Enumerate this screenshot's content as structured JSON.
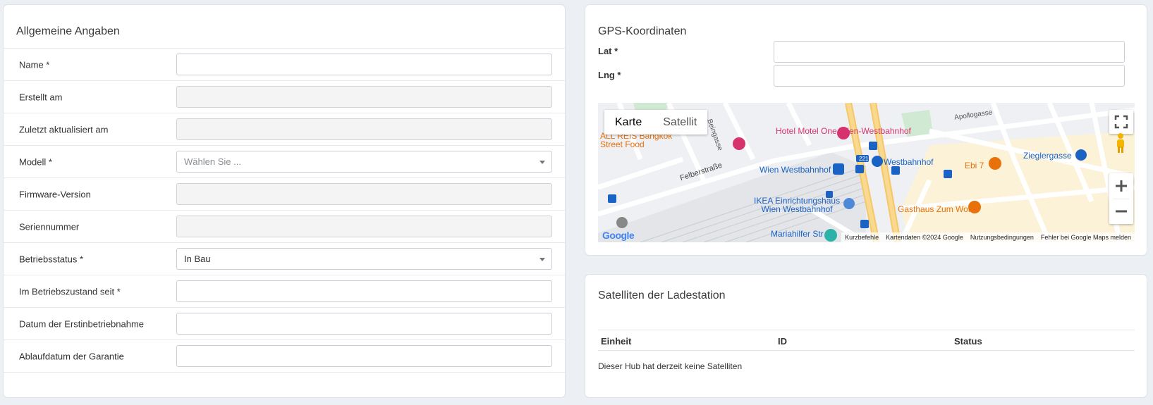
{
  "general": {
    "title": "Allgemeine Angaben",
    "fields": [
      {
        "label": "Name *",
        "value": "",
        "type": "input"
      },
      {
        "label": "Erstellt am",
        "value": "",
        "type": "readonly"
      },
      {
        "label": "Zuletzt aktualisiert am",
        "value": "",
        "type": "readonly"
      },
      {
        "label": "Modell *",
        "value": "Wählen Sie ...",
        "type": "select-placeholder"
      },
      {
        "label": "Firmware-Version",
        "value": "",
        "type": "readonly"
      },
      {
        "label": "Seriennummer",
        "value": "",
        "type": "readonly"
      },
      {
        "label": "Betriebsstatus *",
        "value": "In Bau",
        "type": "select"
      },
      {
        "label": "Im Betriebszustand seit *",
        "value": "",
        "type": "input"
      },
      {
        "label": "Datum der Erstinbetriebnahme",
        "value": "",
        "type": "input"
      },
      {
        "label": "Ablaufdatum der Garantie",
        "value": "",
        "type": "input"
      }
    ]
  },
  "gps": {
    "title": "GPS-Koordinaten",
    "lat_label": "Lat *",
    "lng_label": "Lng *",
    "lat_value": "",
    "lng_value": "",
    "map": {
      "type_map": "Karte",
      "type_satellite": "Satellit",
      "footer": [
        "Kurzbefehle",
        "Kartendaten ©2024 Google",
        "Nutzungsbedingungen",
        "Fehler bei Google Maps melden"
      ],
      "google_logo": "Google",
      "places": [
        {
          "name": "Hotel Motel One\nWien-Westbahnhof",
          "color": "#d6336c"
        },
        {
          "name": "ALL REIS Bangkok\nStreet Food",
          "color": "#e8710a"
        },
        {
          "name": "Felberstraße",
          "color": "#444"
        },
        {
          "name": "Wien Westbahnhof",
          "color": "#1a62c4"
        },
        {
          "name": "Westbahnhof",
          "color": "#1a62c4"
        },
        {
          "name": "Ebi 7",
          "color": "#e8710a"
        },
        {
          "name": "Zieglergasse",
          "color": "#1a62c4"
        },
        {
          "name": "IKEA Einrichtungshaus\nWien Westbahnhof",
          "color": "#1a62c4"
        },
        {
          "name": "Gasthaus Zum Wohl",
          "color": "#e8710a"
        },
        {
          "name": "Mariahilfer Str",
          "color": "#1a62c4"
        },
        {
          "name": "Apollogasse",
          "color": "#555"
        },
        {
          "name": "Beingasse",
          "color": "#555"
        },
        {
          "name": "221",
          "color": "#fff"
        }
      ]
    }
  },
  "satellites": {
    "title": "Satelliten der Ladestation",
    "columns": [
      "Einheit",
      "ID",
      "Status"
    ],
    "empty_text": "Dieser Hub hat derzeit keine Satelliten"
  },
  "colors": {
    "background": "#eceff3",
    "card": "#ffffff",
    "border": "#dde2e8"
  }
}
